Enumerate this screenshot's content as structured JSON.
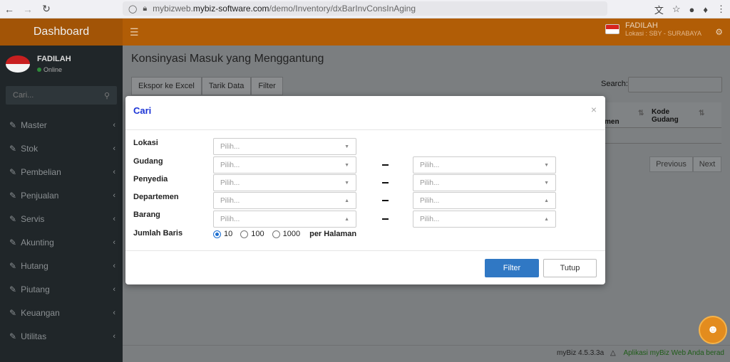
{
  "browser": {
    "back_icon": "arrow-left-icon",
    "forward_icon": "arrow-right-icon",
    "reload_icon": "reload-icon",
    "url_prefix": "mybizweb.",
    "url_domain": "mybiz-software.com",
    "url_path": "/demo/Inventory/dxBarInvConsInAging"
  },
  "header": {
    "brand": "Dashboard",
    "user_name": "FADILAH",
    "user_location": "Lokasi : SBY - SURABAYA"
  },
  "sidebar": {
    "user_name": "FADILAH",
    "status": "Online",
    "search_placeholder": "Cari...",
    "items": [
      {
        "label": "Master"
      },
      {
        "label": "Stok"
      },
      {
        "label": "Pembelian"
      },
      {
        "label": "Penjualan"
      },
      {
        "label": "Servis"
      },
      {
        "label": "Akunting"
      },
      {
        "label": "Hutang"
      },
      {
        "label": "Piutang"
      },
      {
        "label": "Keuangan"
      },
      {
        "label": "Utilitas"
      }
    ]
  },
  "main": {
    "title": "Konsinyasi Masuk yang Menggantung",
    "toolbar": {
      "export": "Ekspor ke Excel",
      "fetch": "Tarik Data",
      "filter": "Filter"
    },
    "search_label": "Search:",
    "column_partial": "men",
    "column_kode": "Kode",
    "column_gudang": "Gudang",
    "pager_prev": "Previous",
    "pager_next": "Next"
  },
  "footer": {
    "version": "myBiz 4.5.3.3a",
    "marquee": "Aplikasi myBiz Web Anda berad"
  },
  "modal": {
    "title": "Cari",
    "close": "×",
    "fields": {
      "lokasi": {
        "label": "Lokasi",
        "placeholder": "Pilih..."
      },
      "gudang": {
        "label": "Gudang",
        "placeholder_from": "Pilih...",
        "placeholder_to": "Pilih..."
      },
      "penyedia": {
        "label": "Penyedia",
        "placeholder_from": "Pilih...",
        "placeholder_to": "Pilih..."
      },
      "departemen": {
        "label": "Departemen",
        "placeholder_from": "Pilih...",
        "placeholder_to": "Pilih..."
      },
      "barang": {
        "label": "Barang",
        "placeholder_from": "Pilih...",
        "placeholder_to": "Pilih..."
      }
    },
    "rows_label": "Jumlah Baris",
    "row_options": [
      "10",
      "100",
      "1000"
    ],
    "row_selected": "10",
    "per_page": "per Halaman",
    "btn_filter": "Filter",
    "btn_close": "Tutup"
  }
}
